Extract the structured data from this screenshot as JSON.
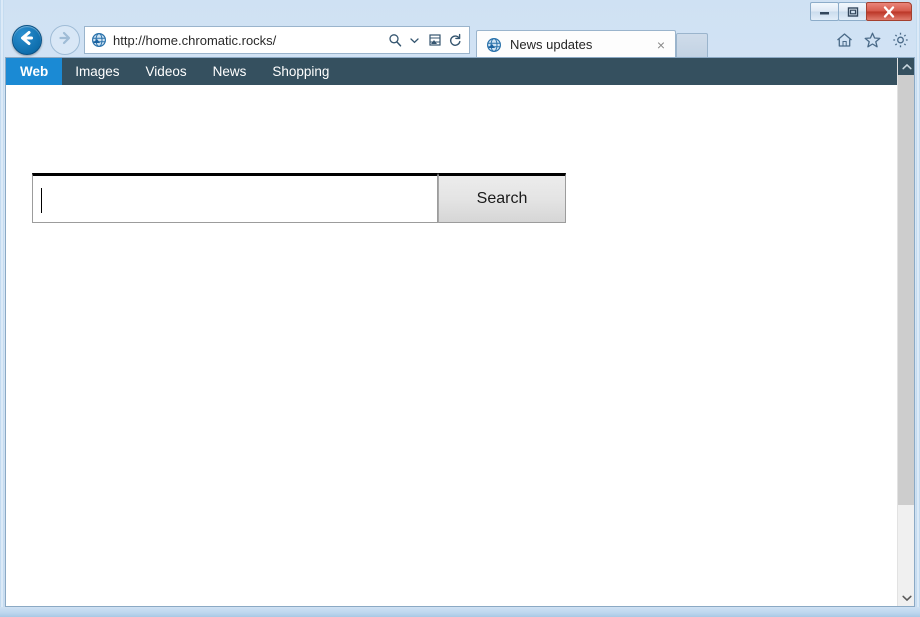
{
  "window": {
    "controls": {
      "minimize_label": "Minimize",
      "maximize_label": "Maximize",
      "close_label": "Close"
    }
  },
  "browser": {
    "back_label": "Back",
    "forward_label": "Forward",
    "address": {
      "url_full": "http://home.chromatic.rocks/",
      "url_scheme": "http://home.",
      "url_domain": "chromatic.rocks",
      "url_path": "/",
      "favicon": "globe-icon",
      "search_icon": "search-magnifier-icon",
      "dropdown_icon": "chevron-down-icon",
      "compat_icon": "compatibility-view-icon",
      "refresh_icon": "refresh-icon"
    },
    "tabs": [
      {
        "title": "News updates",
        "favicon": "globe-icon",
        "close_label": "×",
        "active": true
      }
    ],
    "new_tab_label": "New tab",
    "command_icons": [
      {
        "name": "home-icon",
        "label": "Home"
      },
      {
        "name": "star-icon",
        "label": "Favorites"
      },
      {
        "name": "gear-icon",
        "label": "Tools"
      }
    ]
  },
  "page": {
    "sitenav": {
      "items": [
        {
          "label": "Web",
          "active": true
        },
        {
          "label": "Images",
          "active": false
        },
        {
          "label": "Videos",
          "active": false
        },
        {
          "label": "News",
          "active": false
        },
        {
          "label": "Shopping",
          "active": false
        }
      ],
      "background_color": "#35505f",
      "active_color": "#1b8ad4"
    },
    "search": {
      "input_value": "",
      "input_placeholder": "",
      "button_label": "Search",
      "focused": true
    }
  },
  "scrollbar": {
    "up_arrow": "chevron-up-icon",
    "down_arrow": "chevron-down-icon",
    "thumb_label": "Vertical scroll thumb"
  }
}
